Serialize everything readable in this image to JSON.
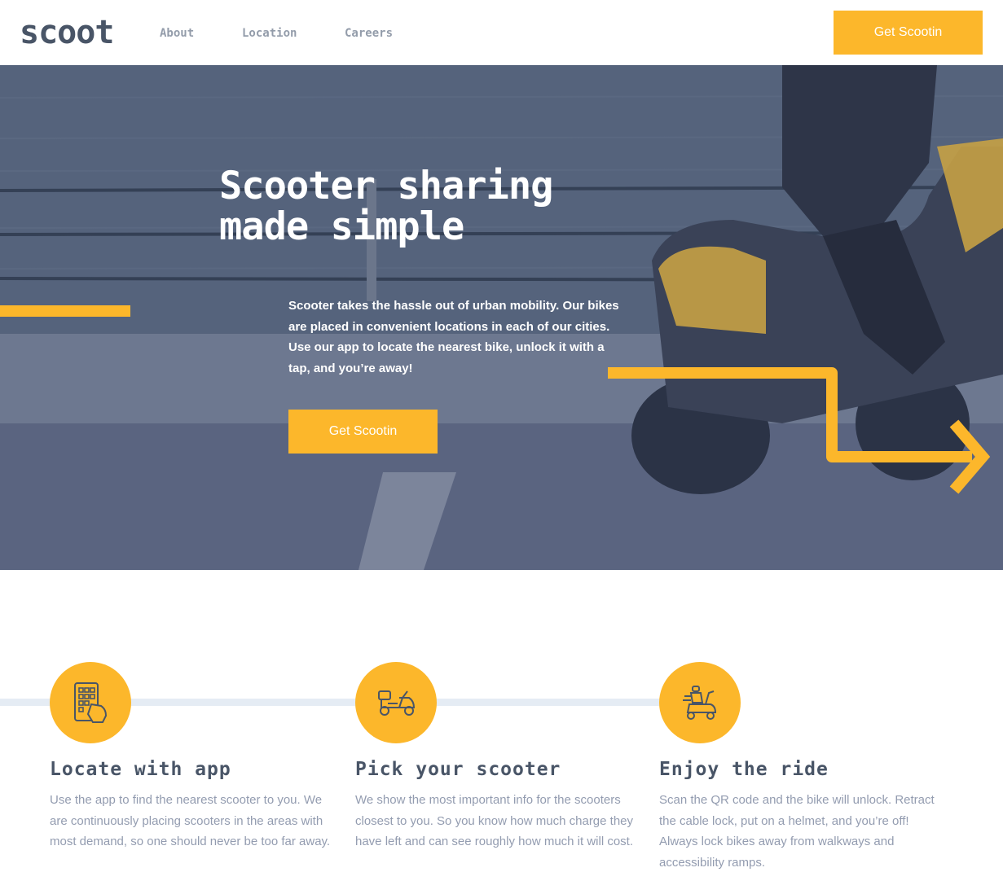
{
  "header": {
    "logo": "scoot",
    "nav": [
      "About",
      "Location",
      "Careers"
    ],
    "cta_label": "Get Scootin"
  },
  "hero": {
    "title_line1": "Scooter sharing",
    "title_line2": "made simple",
    "text": "Scooter takes the hassle out of urban mobility. Our bikes are placed in convenient locations in each of our cities. Use our app to locate the nearest bike, unlock it with a tap, and you’re away!",
    "cta_label": "Get Scootin"
  },
  "features": [
    {
      "icon": "phone-app-icon",
      "title": "Locate with app",
      "text": "Use the app to find the nearest scooter to you. We are continuously placing scooters in the areas with most demand, so one should never be too far away."
    },
    {
      "icon": "scooter-icon",
      "title": "Pick your scooter",
      "text": "We show the most important info for the scooters closest to you. So you know how much charge they have left and can see roughly how much it will cost."
    },
    {
      "icon": "scooter-ride-icon",
      "title": "Enjoy the ride",
      "text": "Scan the QR code and the bike will unlock. Retract the cable lock, put on a helmet, and you’re off! Always lock bikes away from walkways and accessibility ramps."
    }
  ],
  "colors": {
    "accent": "#fcb72b",
    "dark_navy": "#495567",
    "muted_text": "#939cb0",
    "hero_overlay": "#4a5975"
  }
}
